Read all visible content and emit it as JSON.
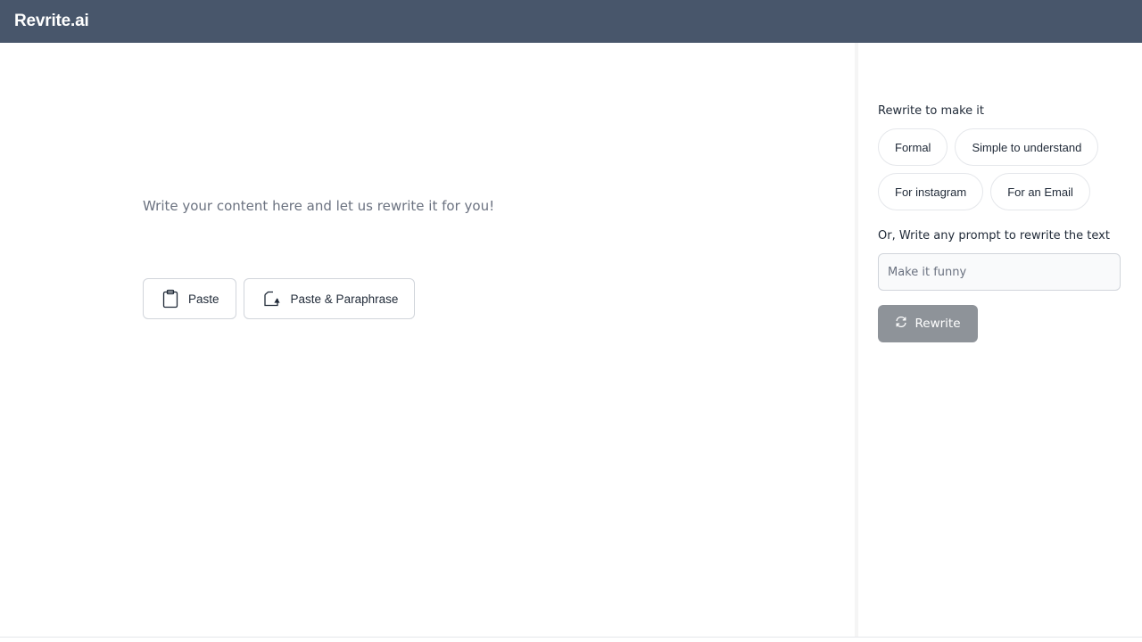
{
  "header": {
    "brand": "Revrite.ai",
    "background_color": "#48566b"
  },
  "editor": {
    "placeholder": "Write your content here and let us rewrite it for you!",
    "paste_label": "Paste",
    "paste_icon": "clipboard-icon",
    "paste_paraphrase_label": "Paste & Paraphrase",
    "paste_paraphrase_icon": "paste-paraphrase-icon"
  },
  "sidebar": {
    "heading": "Rewrite to make it",
    "chips": [
      "Formal",
      "Simple to understand",
      "For instagram",
      "For an Email"
    ],
    "prompt_label": "Or, Write any prompt to rewrite the text",
    "prompt_placeholder": "Make it funny",
    "rewrite_label": "Rewrite",
    "rewrite_icon": "refresh-icon",
    "rewrite_color": "#8e9399"
  }
}
